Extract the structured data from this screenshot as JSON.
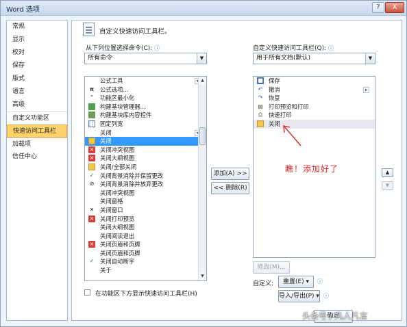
{
  "window": {
    "title": "Word 选项",
    "help_label": "?",
    "close_label": "X"
  },
  "nav": {
    "items": [
      {
        "label": "常规",
        "name": "nav-item-general"
      },
      {
        "label": "显示",
        "name": "nav-item-display"
      },
      {
        "label": "校对",
        "name": "nav-item-proofing"
      },
      {
        "label": "保存",
        "name": "nav-item-save"
      },
      {
        "label": "版式",
        "name": "nav-item-layout"
      },
      {
        "label": "语言",
        "name": "nav-item-language"
      },
      {
        "label": "高级",
        "name": "nav-item-advanced"
      },
      {
        "label": "自定义功能区",
        "name": "nav-item-customize-ribbon"
      },
      {
        "label": "快速访问工具栏",
        "name": "nav-item-quick-access-toolbar"
      },
      {
        "label": "加载项",
        "name": "nav-item-addins"
      },
      {
        "label": "信任中心",
        "name": "nav-item-trust-center"
      }
    ],
    "active_index": 8
  },
  "header": {
    "title": "自定义快速访问工具栏。"
  },
  "left": {
    "label": "从下列位置选择命令(C):",
    "dropdown_value": "所有命令",
    "commands": [
      {
        "label": "公式工具",
        "icon": "none",
        "sub": true
      },
      {
        "label": "公式选项...",
        "icon": "pi-icon"
      },
      {
        "label": "功能区最小化",
        "icon": "ribbon-minimize-icon"
      },
      {
        "label": "构建基块管理器...",
        "icon": "building-blocks-icon"
      },
      {
        "label": "构建基块库内容控件",
        "icon": "building-block-control-icon"
      },
      {
        "label": "固定列宽",
        "icon": "fixed-column-width-icon"
      },
      {
        "label": "关闭",
        "icon": "none",
        "sub": true
      },
      {
        "label": "关闭",
        "icon": "folder-icon",
        "selected": true
      },
      {
        "label": "关闭冲突视图",
        "icon": "close-red-icon"
      },
      {
        "label": "关闭大纲视图",
        "icon": "close-red-icon"
      },
      {
        "label": "关闭/全部关闭",
        "icon": "folder-icon"
      },
      {
        "label": "关闭背景消除并保留更改",
        "icon": "check-icon"
      },
      {
        "label": "关闭背景消除并放弃更改",
        "icon": "discard-icon"
      },
      {
        "label": "关闭冲突视图",
        "icon": "none"
      },
      {
        "label": "关闭窗格",
        "icon": "none"
      },
      {
        "label": "关闭窗口",
        "icon": "small-x-icon"
      },
      {
        "label": "关闭打印预览",
        "icon": "close-red-icon"
      },
      {
        "label": "关闭大纲视图",
        "icon": "none"
      },
      {
        "label": "关闭阅读退出",
        "icon": "none"
      },
      {
        "label": "关闭页眉和页脚",
        "icon": "close-red-icon"
      },
      {
        "label": "关闭页眉和页脚",
        "icon": "none"
      },
      {
        "label": "关闭自动断字",
        "icon": "check-icon"
      },
      {
        "label": "关于",
        "icon": "none"
      }
    ],
    "show_below_label": "在功能区下方显示快速访问工具栏(H)"
  },
  "middle": {
    "add_label": "添加(A) >>",
    "remove_label": "<< 删除(R)"
  },
  "right": {
    "label": "自定义快速访问工具栏(Q):",
    "dropdown_value": "用于所有文档(默认)",
    "commands": [
      {
        "label": "保存",
        "icon": "save-icon"
      },
      {
        "label": "撤消",
        "icon": "undo-icon",
        "sub": true
      },
      {
        "label": "恢复",
        "icon": "redo-icon"
      },
      {
        "label": "打印预览和打印",
        "icon": "print-preview-icon"
      },
      {
        "label": "快速打印",
        "icon": "quick-print-icon"
      },
      {
        "label": "关闭",
        "icon": "folder-icon",
        "highlight": true
      }
    ],
    "modify_label": "修改(M)...",
    "customize_label": "自定义:",
    "reset_label": "重置(E)",
    "import_export_label": "导入/导出(P)"
  },
  "annotation": {
    "text": "瞧！添加好了",
    "color": "#e0262a"
  },
  "footer": {
    "ok_label": "确定",
    "watermark": "头条号 / 凡人凡言"
  }
}
